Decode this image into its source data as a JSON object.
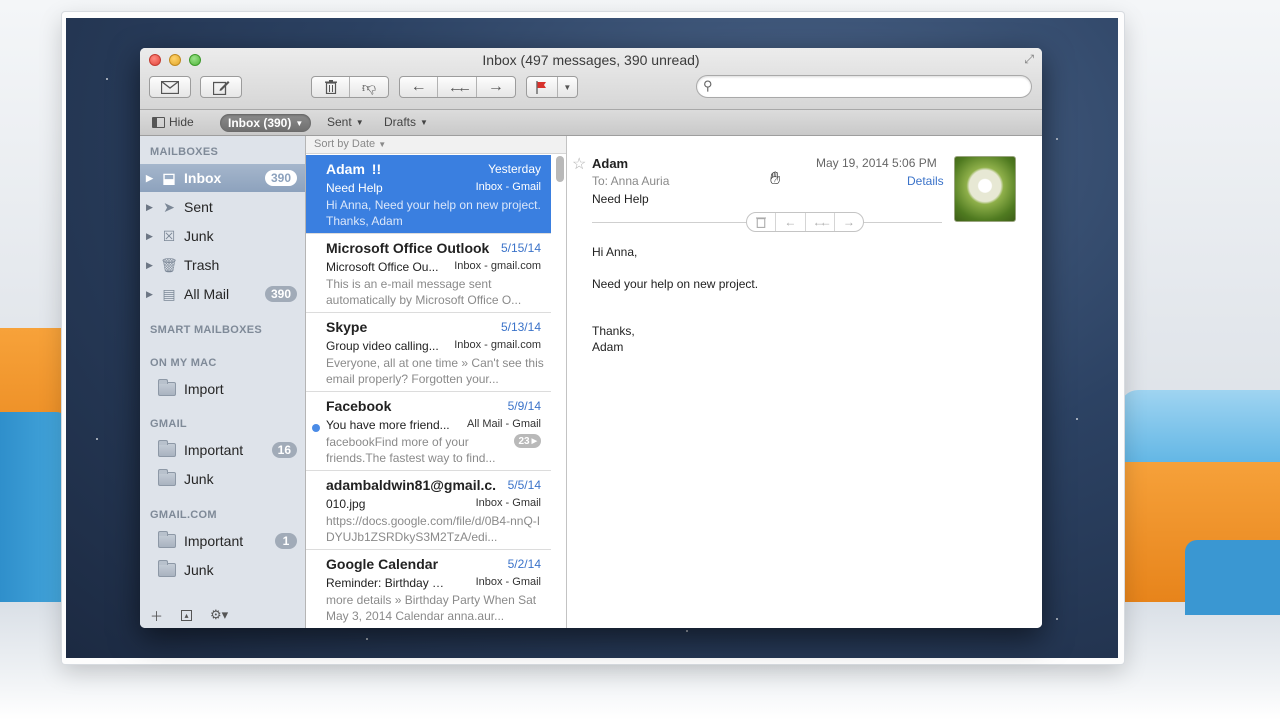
{
  "window": {
    "title": "Inbox (497 messages, 390 unread)"
  },
  "toolbar": {
    "get_mail_icon": "envelope-icon",
    "compose_icon": "compose-icon",
    "delete_icon": "trash-icon",
    "junk_icon": "thumbs-down-icon",
    "reply_icon": "reply-icon",
    "reply_all_icon": "reply-all-icon",
    "forward_icon": "forward-icon",
    "flag_icon": "flag-icon",
    "search_placeholder": ""
  },
  "favorites": {
    "hide": "Hide",
    "inbox": "Inbox (390)",
    "sent": "Sent",
    "drafts": "Drafts"
  },
  "sidebar": {
    "mailboxes_header": "MAILBOXES",
    "mailboxes": [
      {
        "label": "Inbox",
        "badge": "390",
        "icon": "inbox-tray-icon"
      },
      {
        "label": "Sent",
        "badge": "",
        "icon": "paper-plane-icon"
      },
      {
        "label": "Junk",
        "badge": "",
        "icon": "junk-bin-icon"
      },
      {
        "label": "Trash",
        "badge": "",
        "icon": "trash-icon"
      },
      {
        "label": "All Mail",
        "badge": "390",
        "icon": "archive-box-icon"
      }
    ],
    "smart_header": "SMART MAILBOXES",
    "onmymac_header": "ON MY MAC",
    "onmymac": [
      {
        "label": "Import"
      }
    ],
    "gmail_header": "GMAIL",
    "gmail": [
      {
        "label": "Important",
        "badge": "16"
      },
      {
        "label": "Junk",
        "badge": ""
      }
    ],
    "gmailcom_header": "GMAIL.COM",
    "gmailcom": [
      {
        "label": "Important",
        "badge": "1"
      },
      {
        "label": "Junk",
        "badge": ""
      }
    ]
  },
  "list": {
    "sort_label": "Sort by Date",
    "messages": [
      {
        "from": "Adam",
        "flag": "!!",
        "date": "Yesterday",
        "subject": "Need Help",
        "mailbox": "Inbox - Gmail",
        "preview": "Hi Anna, Need your help on new project. Thanks, Adam"
      },
      {
        "from": "Microsoft Office Outlook",
        "date": "5/15/14",
        "subject": "Microsoft Office Ou...",
        "mailbox": "Inbox - gmail.com",
        "preview": "This is an e-mail message sent automatically by Microsoft Office O..."
      },
      {
        "from": "Skype",
        "date": "5/13/14",
        "subject": "Group video calling...",
        "mailbox": "Inbox - gmail.com",
        "preview": "Everyone, all at one time » Can't see this email properly? Forgotten your..."
      },
      {
        "from": "Facebook",
        "date": "5/9/14",
        "subject": "You have more friend...",
        "mailbox": "All Mail - Gmail",
        "preview": "facebookFind more of your friends.The fastest way to find...",
        "thread": "23"
      },
      {
        "from": "adambaldwin81@gmail.c...",
        "date": "5/5/14",
        "subject": "010.jpg",
        "mailbox": "Inbox - Gmail",
        "preview": "https://docs.google.com/file/d/0B4-nnQ-IDYUJb1ZSRDkyS3M2TzA/edi..."
      },
      {
        "from": "Google Calendar",
        "date": "5/2/14",
        "subject": "Reminder: Birthday Pa...",
        "mailbox": "Inbox - Gmail",
        "preview": "more details » Birthday Party When Sat May 3, 2014 Calendar anna.aur..."
      }
    ]
  },
  "reader": {
    "from": "Adam",
    "to": "To:  Anna Auria",
    "subject": "Need Help",
    "date": "May 19, 2014   5:06 PM",
    "details": "Details",
    "body": {
      "greeting": "Hi Anna,",
      "line1": "Need your help on new project.",
      "signoff": "Thanks,",
      "signature": "Adam"
    }
  }
}
